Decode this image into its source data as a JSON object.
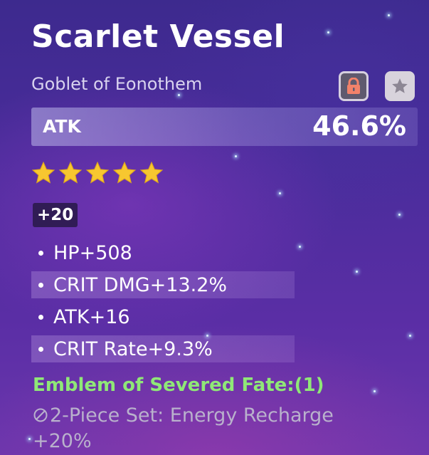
{
  "artifact": {
    "name": "Scarlet Vessel",
    "type": "Goblet of Eonothem",
    "main_stat": {
      "name": "ATK",
      "value": "46.6%"
    },
    "rarity": 5,
    "level": "+20",
    "substats": [
      {
        "label": "HP+508"
      },
      {
        "label": "CRIT DMG+13.2%"
      },
      {
        "label": "ATK+16"
      },
      {
        "label": "CRIT Rate+9.3%"
      }
    ],
    "set": {
      "name": "Emblem of Severed Fate:(1)",
      "bonus_line1": "2-Piece Set: Energy Recharge",
      "bonus_line2": "+20%"
    }
  },
  "controls": {
    "lock_icon": "lock-icon",
    "favorite_icon": "star-icon",
    "lock_state": "locked"
  },
  "colors": {
    "set_active": "#8fe877",
    "set_inactive": "#b9b1cc",
    "star": "#f7c730",
    "lock": "#f2826a"
  }
}
